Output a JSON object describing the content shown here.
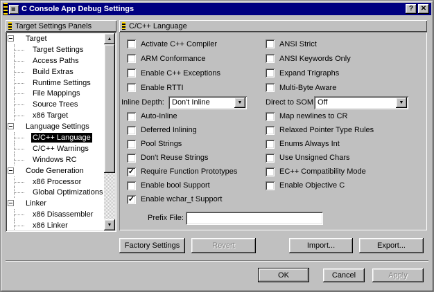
{
  "window": {
    "title": "C Console App Debug Settings",
    "help_glyph": "?",
    "close_glyph": "✕"
  },
  "icons": {
    "check": "✓",
    "dropdown_arrow": "▼",
    "scroll_up": "▲",
    "scroll_down": "▼"
  },
  "colors": {
    "titlebar": "#000080",
    "face": "#c0c0c0",
    "selection": "#000000",
    "stripe": "#ffd800"
  },
  "left_panel": {
    "header": "Target Settings Panels",
    "tree": [
      {
        "label": "Target",
        "level": 0,
        "selected": false
      },
      {
        "label": "Target Settings",
        "level": 1,
        "selected": false
      },
      {
        "label": "Access Paths",
        "level": 1,
        "selected": false
      },
      {
        "label": "Build Extras",
        "level": 1,
        "selected": false
      },
      {
        "label": "Runtime Settings",
        "level": 1,
        "selected": false
      },
      {
        "label": "File Mappings",
        "level": 1,
        "selected": false
      },
      {
        "label": "Source Trees",
        "level": 1,
        "selected": false
      },
      {
        "label": "x86 Target",
        "level": 1,
        "selected": false
      },
      {
        "label": "Language Settings",
        "level": 0,
        "selected": false
      },
      {
        "label": "C/C++ Language",
        "level": 1,
        "selected": true
      },
      {
        "label": "C/C++ Warnings",
        "level": 1,
        "selected": false
      },
      {
        "label": "Windows RC",
        "level": 1,
        "selected": false
      },
      {
        "label": "Code Generation",
        "level": 0,
        "selected": false
      },
      {
        "label": "x86 Processor",
        "level": 1,
        "selected": false
      },
      {
        "label": "Global Optimizations",
        "level": 1,
        "selected": false
      },
      {
        "label": "Linker",
        "level": 0,
        "selected": false
      },
      {
        "label": "x86 Disassembler",
        "level": 1,
        "selected": false
      },
      {
        "label": "x86 Linker",
        "level": 1,
        "selected": false
      }
    ]
  },
  "right_panel": {
    "header": "C/C++ Language",
    "checkboxes_top_left": [
      {
        "label": "Activate C++ Compiler",
        "checked": false
      },
      {
        "label": "ARM Conformance",
        "checked": false
      },
      {
        "label": "Enable C++ Exceptions",
        "checked": false
      },
      {
        "label": "Enable RTTI",
        "checked": false
      }
    ],
    "checkboxes_top_right": [
      {
        "label": "ANSI Strict",
        "checked": false
      },
      {
        "label": "ANSI Keywords Only",
        "checked": false
      },
      {
        "label": "Expand Trigraphs",
        "checked": false
      },
      {
        "label": "Multi-Byte Aware",
        "checked": false
      }
    ],
    "inline_depth": {
      "label": "Inline Depth:",
      "value": "Don't Inline"
    },
    "direct_to_som": {
      "label": "Direct to SOM:",
      "value": "Off"
    },
    "checkboxes_bottom_left": [
      {
        "label": "Auto-Inline",
        "checked": false
      },
      {
        "label": "Deferred Inlining",
        "checked": false
      },
      {
        "label": "Pool Strings",
        "checked": false
      },
      {
        "label": "Don't Reuse Strings",
        "checked": false
      },
      {
        "label": "Require Function Prototypes",
        "checked": true
      },
      {
        "label": "Enable bool Support",
        "checked": false
      },
      {
        "label": "Enable wchar_t Support",
        "checked": true
      }
    ],
    "checkboxes_bottom_right": [
      {
        "label": "Map newlines to CR",
        "checked": false
      },
      {
        "label": "Relaxed Pointer Type Rules",
        "checked": false
      },
      {
        "label": "Enums Always Int",
        "checked": false
      },
      {
        "label": "Use Unsigned Chars",
        "checked": false
      },
      {
        "label": "EC++ Compatibility Mode",
        "checked": false
      },
      {
        "label": "Enable Objective C",
        "checked": false
      }
    ],
    "prefix": {
      "label": "Prefix File:",
      "value": ""
    }
  },
  "buttons": {
    "factory": "Factory Settings",
    "revert": "Revert",
    "import": "Import...",
    "export": "Export...",
    "ok": "OK",
    "cancel": "Cancel",
    "apply": "Apply"
  }
}
